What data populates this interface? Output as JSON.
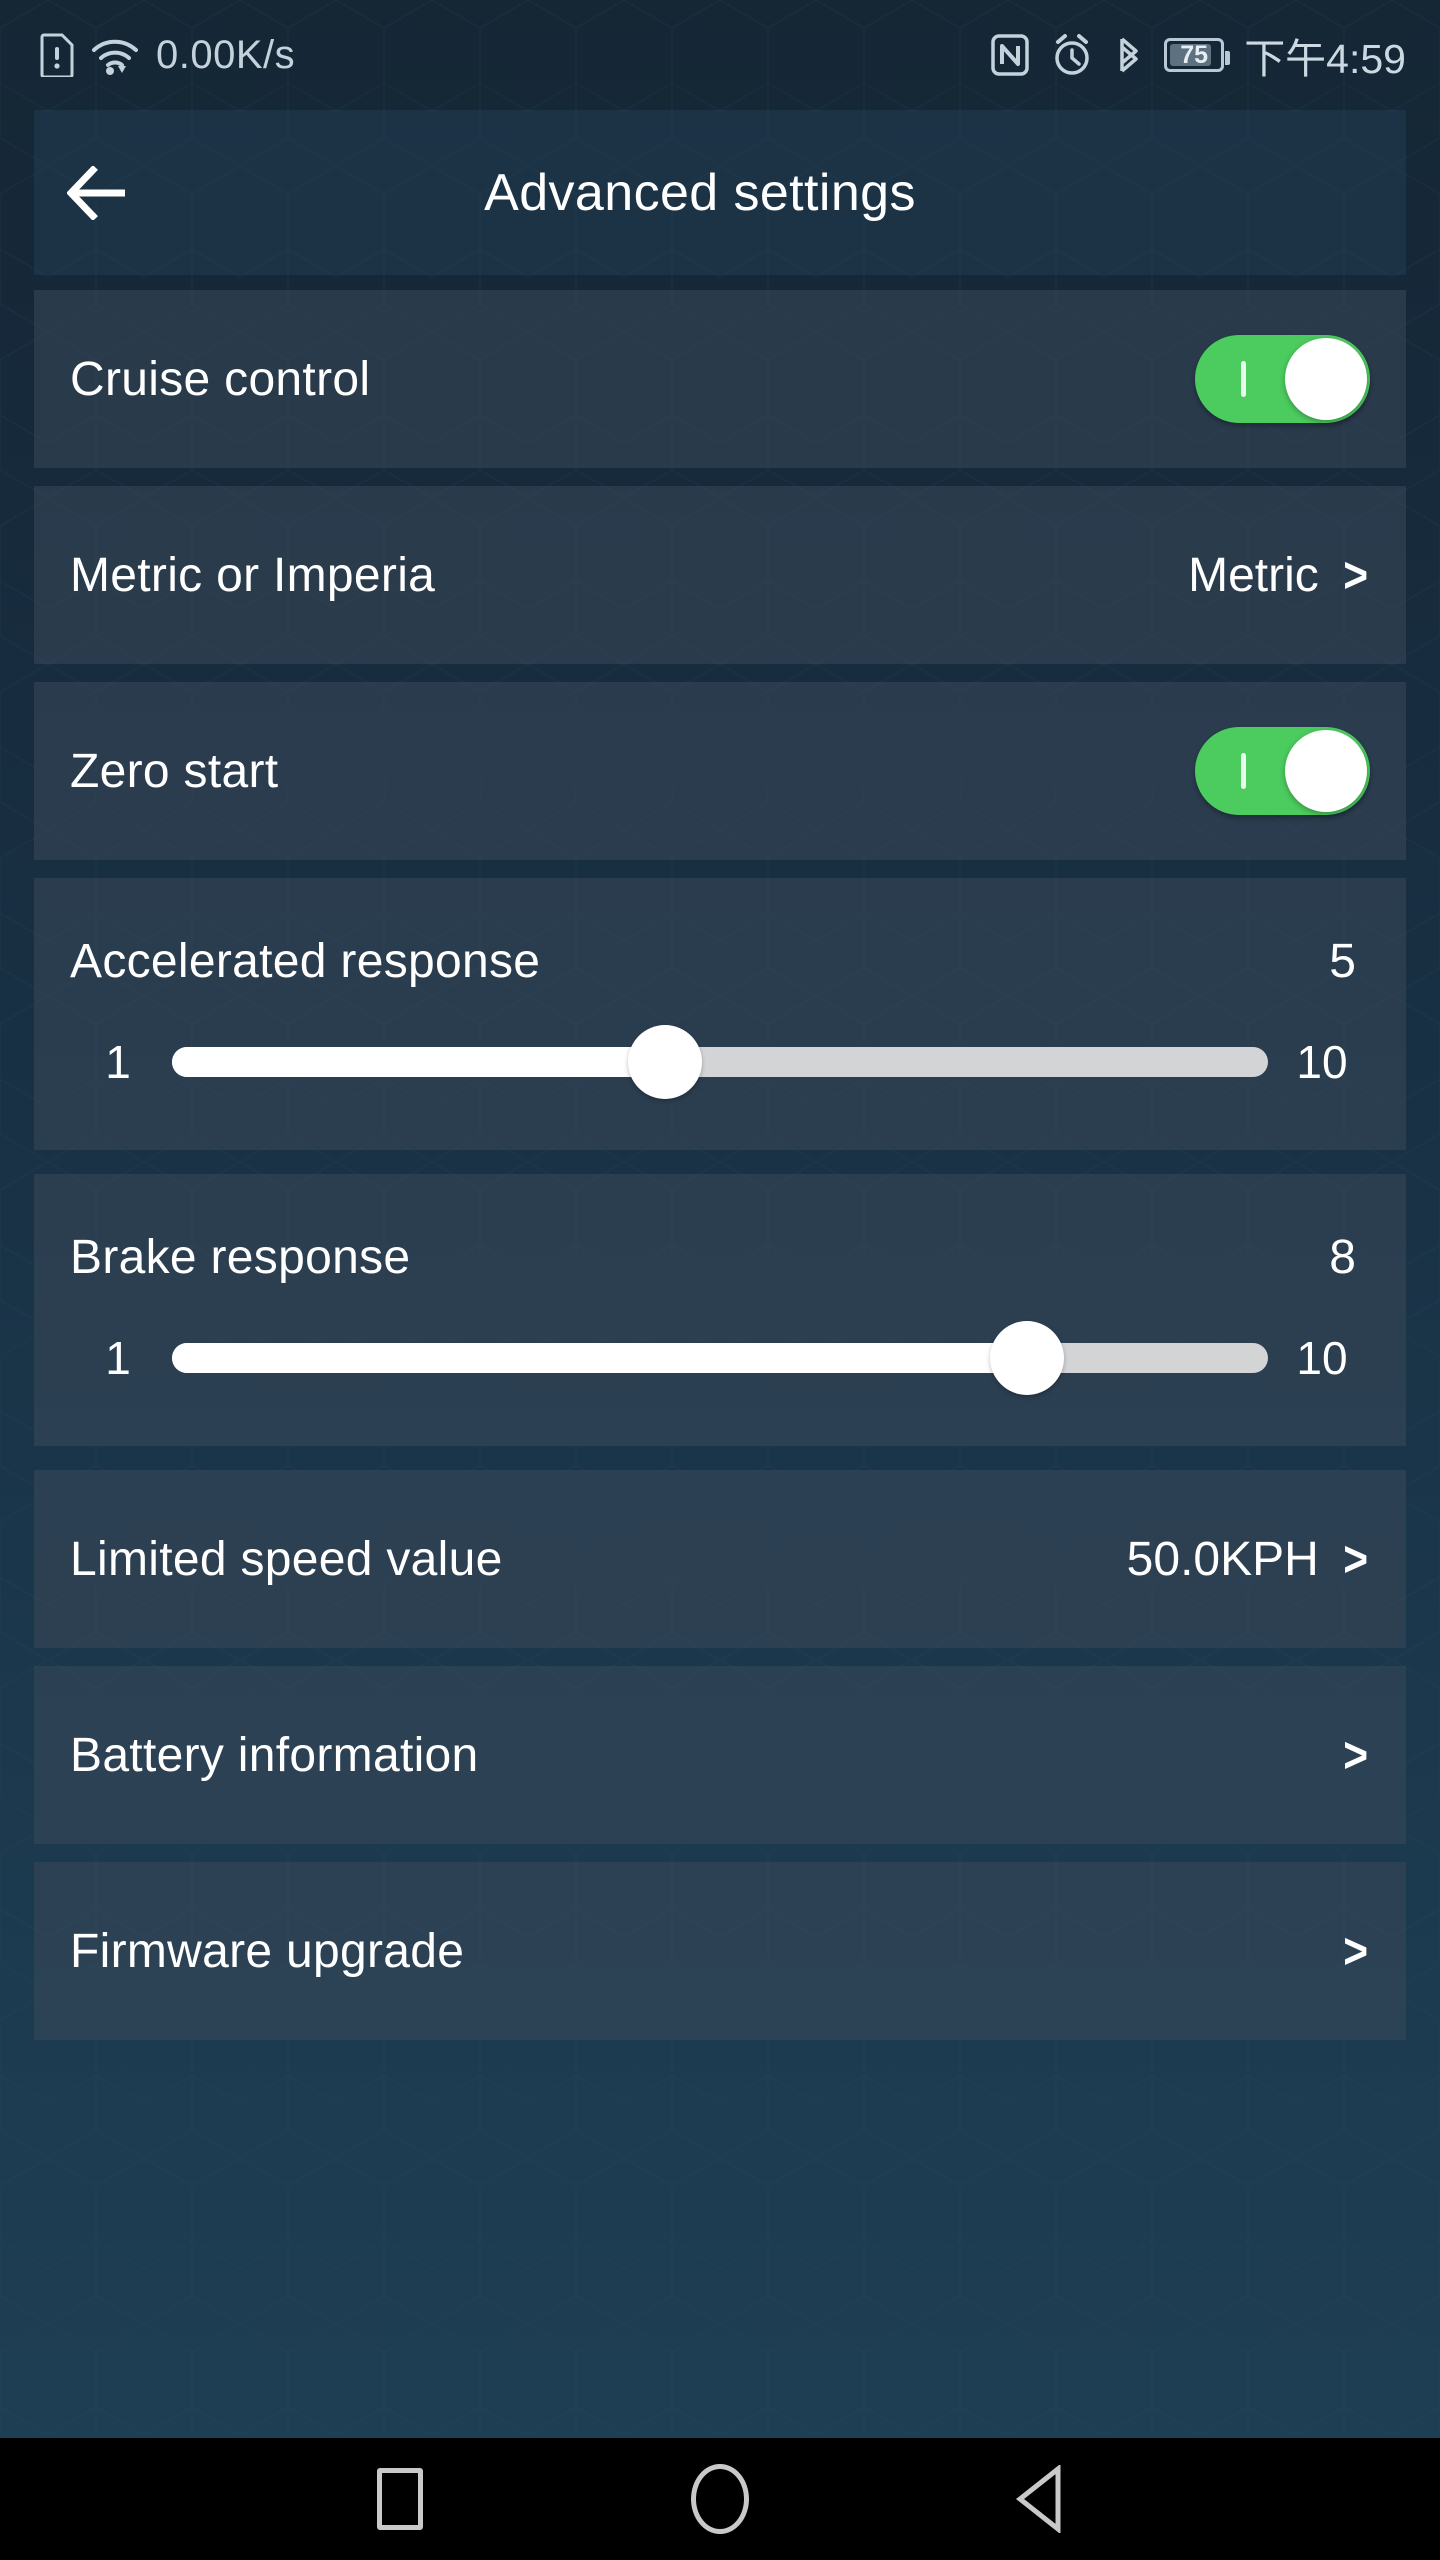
{
  "status_bar": {
    "left_icons": [
      "sim-warning-icon",
      "wifi-icon"
    ],
    "network_speed": "0.00K/s",
    "right_icons": [
      "nfc-icon",
      "alarm-icon",
      "bluetooth-icon"
    ],
    "battery_level": "75",
    "time": "下午4:59"
  },
  "appbar": {
    "back_icon": "arrow-left-icon",
    "title": "Advanced settings"
  },
  "rows": [
    {
      "type": "toggle",
      "label": "Cruise control",
      "enabled": true
    },
    {
      "type": "value",
      "label": "Metric or Imperia",
      "value": "Metric",
      "chevron": ">"
    },
    {
      "type": "toggle",
      "label": "Zero start",
      "enabled": true
    },
    {
      "type": "slider",
      "label": "Accelerated response",
      "value": "5",
      "min": "1",
      "max": "10",
      "percent": 45
    },
    {
      "type": "slider",
      "label": "Brake response",
      "value": "8",
      "min": "1",
      "max": "10",
      "percent": 78
    },
    {
      "type": "value",
      "label": "Limited speed value",
      "value": "50.0KPH",
      "chevron": ">"
    },
    {
      "type": "value",
      "label": "Battery information",
      "value": "",
      "chevron": ">"
    },
    {
      "type": "value",
      "label": "Firmware upgrade",
      "value": "",
      "chevron": ">"
    }
  ],
  "navbar": {
    "recents_icon": "square-icon",
    "home_icon": "circle-icon",
    "back_icon": "triangle-left-icon"
  },
  "colors": {
    "toggle_on": "#4ccb5e",
    "bg_top": "#152735",
    "bg_bottom": "#1e3e54",
    "card": "rgba(58,73,90,.55)",
    "text": "#ffffff"
  }
}
